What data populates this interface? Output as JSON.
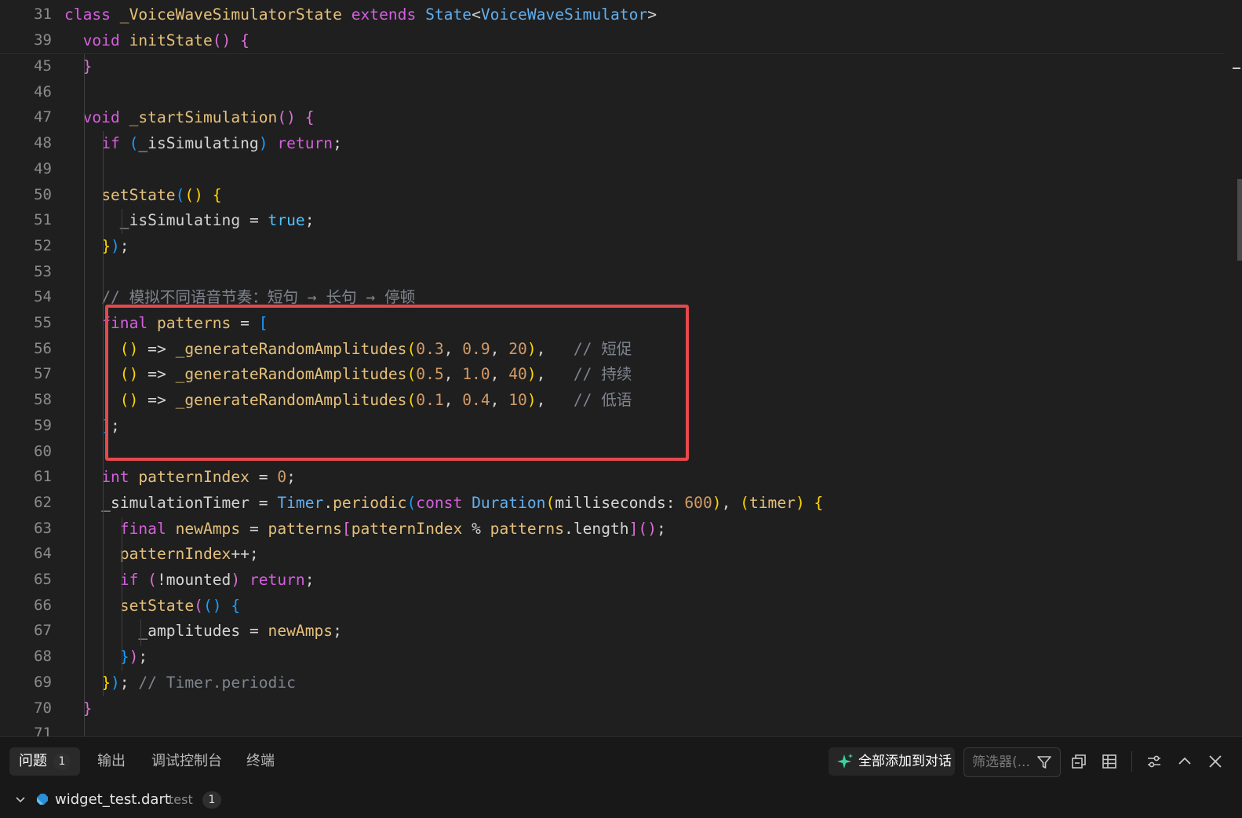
{
  "editor": {
    "sticky": [
      {
        "ln": "31",
        "tokens": [
          [
            "kw",
            "class "
          ],
          [
            "fn",
            "_VoiceWaveSimulatorState "
          ],
          [
            "kw",
            "extends "
          ],
          [
            "cl",
            "State"
          ],
          [
            "op",
            "<"
          ],
          [
            "cl",
            "VoiceWaveSimulator"
          ],
          [
            "op",
            ">"
          ]
        ]
      },
      {
        "ln": "39",
        "tokens": [
          [
            "tx",
            "  "
          ],
          [
            "kw",
            "void "
          ],
          [
            "fn",
            "initState"
          ],
          [
            "b2",
            "() {"
          ]
        ]
      }
    ],
    "lines": [
      {
        "ln": "45",
        "tokens": [
          [
            "tx",
            "  "
          ],
          [
            "b2",
            "}"
          ]
        ]
      },
      {
        "ln": "46",
        "tokens": []
      },
      {
        "ln": "47",
        "tokens": [
          [
            "tx",
            "  "
          ],
          [
            "kw",
            "void "
          ],
          [
            "fn",
            "_startSimulation"
          ],
          [
            "b2",
            "() {"
          ]
        ]
      },
      {
        "ln": "48",
        "tokens": [
          [
            "tx",
            "    "
          ],
          [
            "kw",
            "if "
          ],
          [
            "b3",
            "("
          ],
          [
            "tx",
            "_isSimulating"
          ],
          [
            "b3",
            ")"
          ],
          [
            "tx",
            " "
          ],
          [
            "kw",
            "return"
          ],
          [
            "op",
            ";"
          ]
        ]
      },
      {
        "ln": "49",
        "tokens": []
      },
      {
        "ln": "50",
        "tokens": [
          [
            "tx",
            "    "
          ],
          [
            "fn",
            "setState"
          ],
          [
            "b3",
            "("
          ],
          [
            "b1",
            "() {"
          ]
        ]
      },
      {
        "ln": "51",
        "tokens": [
          [
            "tx",
            "      _isSimulating "
          ],
          [
            "op",
            "= "
          ],
          [
            "ty",
            "true"
          ],
          [
            "op",
            ";"
          ]
        ]
      },
      {
        "ln": "52",
        "tokens": [
          [
            "tx",
            "    "
          ],
          [
            "b1",
            "}"
          ],
          [
            "b3",
            ")"
          ],
          [
            "op",
            ";"
          ]
        ]
      },
      {
        "ln": "53",
        "tokens": []
      },
      {
        "ln": "54",
        "tokens": [
          [
            "tx",
            "    "
          ],
          [
            "cm",
            "// 模拟不同语音节奏：短句 → 长句 → 停顿"
          ]
        ]
      },
      {
        "ln": "55",
        "tokens": [
          [
            "tx",
            "    "
          ],
          [
            "kw",
            "final "
          ],
          [
            "vr",
            "patterns "
          ],
          [
            "op",
            "= "
          ],
          [
            "b3",
            "["
          ]
        ]
      },
      {
        "ln": "56",
        "tokens": [
          [
            "tx",
            "      "
          ],
          [
            "b1",
            "()"
          ],
          [
            "op",
            " => "
          ],
          [
            "fn",
            "_generateRandomAmplitudes"
          ],
          [
            "b1",
            "("
          ],
          [
            "nm",
            "0.3"
          ],
          [
            "op",
            ", "
          ],
          [
            "nm",
            "0.9"
          ],
          [
            "op",
            ", "
          ],
          [
            "nm",
            "20"
          ],
          [
            "b1",
            ")"
          ],
          [
            "op",
            ",   "
          ],
          [
            "cm",
            "// 短促"
          ]
        ]
      },
      {
        "ln": "57",
        "tokens": [
          [
            "tx",
            "      "
          ],
          [
            "b1",
            "()"
          ],
          [
            "op",
            " => "
          ],
          [
            "fn",
            "_generateRandomAmplitudes"
          ],
          [
            "b1",
            "("
          ],
          [
            "nm",
            "0.5"
          ],
          [
            "op",
            ", "
          ],
          [
            "nm",
            "1.0"
          ],
          [
            "op",
            ", "
          ],
          [
            "nm",
            "40"
          ],
          [
            "b1",
            ")"
          ],
          [
            "op",
            ",   "
          ],
          [
            "cm",
            "// 持续"
          ]
        ]
      },
      {
        "ln": "58",
        "tokens": [
          [
            "tx",
            "      "
          ],
          [
            "b1",
            "()"
          ],
          [
            "op",
            " => "
          ],
          [
            "fn",
            "_generateRandomAmplitudes"
          ],
          [
            "b1",
            "("
          ],
          [
            "nm",
            "0.1"
          ],
          [
            "op",
            ", "
          ],
          [
            "nm",
            "0.4"
          ],
          [
            "op",
            ", "
          ],
          [
            "nm",
            "10"
          ],
          [
            "b1",
            ")"
          ],
          [
            "op",
            ",   "
          ],
          [
            "cm",
            "// 低语"
          ]
        ]
      },
      {
        "ln": "59",
        "tokens": [
          [
            "tx",
            "    "
          ],
          [
            "b3",
            "]"
          ],
          [
            "op",
            ";"
          ]
        ]
      },
      {
        "ln": "60",
        "tokens": []
      },
      {
        "ln": "61",
        "tokens": [
          [
            "tx",
            "    "
          ],
          [
            "kw",
            "int "
          ],
          [
            "vr",
            "patternIndex "
          ],
          [
            "op",
            "= "
          ],
          [
            "nm",
            "0"
          ],
          [
            "op",
            ";"
          ]
        ]
      },
      {
        "ln": "62",
        "tokens": [
          [
            "tx",
            "    _simulationTimer "
          ],
          [
            "op",
            "= "
          ],
          [
            "cl",
            "Timer"
          ],
          [
            "op",
            "."
          ],
          [
            "fn",
            "periodic"
          ],
          [
            "b3",
            "("
          ],
          [
            "kw",
            "const "
          ],
          [
            "cl",
            "Duration"
          ],
          [
            "b1",
            "("
          ],
          [
            "tx",
            "milliseconds: "
          ],
          [
            "nm",
            "600"
          ],
          [
            "b1",
            ")"
          ],
          [
            "op",
            ", "
          ],
          [
            "b1",
            "("
          ],
          [
            "vr",
            "timer"
          ],
          [
            "b1",
            ")"
          ],
          [
            "tx",
            " "
          ],
          [
            "b1",
            "{"
          ]
        ]
      },
      {
        "ln": "63",
        "tokens": [
          [
            "tx",
            "      "
          ],
          [
            "kw",
            "final "
          ],
          [
            "vr",
            "newAmps "
          ],
          [
            "op",
            "= "
          ],
          [
            "vr",
            "patterns"
          ],
          [
            "b2",
            "["
          ],
          [
            "vr",
            "patternIndex "
          ],
          [
            "op",
            "% "
          ],
          [
            "vr",
            "patterns"
          ],
          [
            "op",
            "."
          ],
          [
            "tx",
            "length"
          ],
          [
            "b2",
            "]"
          ],
          [
            "b2",
            "()"
          ],
          [
            "op",
            ";"
          ]
        ]
      },
      {
        "ln": "64",
        "tokens": [
          [
            "tx",
            "      "
          ],
          [
            "vr",
            "patternIndex"
          ],
          [
            "op",
            "++;"
          ]
        ]
      },
      {
        "ln": "65",
        "tokens": [
          [
            "tx",
            "      "
          ],
          [
            "kw",
            "if "
          ],
          [
            "b2",
            "("
          ],
          [
            "op",
            "!"
          ],
          [
            "tx",
            "mounted"
          ],
          [
            "b2",
            ")"
          ],
          [
            "tx",
            " "
          ],
          [
            "kw",
            "return"
          ],
          [
            "op",
            ";"
          ]
        ]
      },
      {
        "ln": "66",
        "tokens": [
          [
            "tx",
            "      "
          ],
          [
            "fn",
            "setState"
          ],
          [
            "b2",
            "("
          ],
          [
            "b3",
            "() {"
          ]
        ]
      },
      {
        "ln": "67",
        "tokens": [
          [
            "tx",
            "        _amplitudes "
          ],
          [
            "op",
            "= "
          ],
          [
            "vr",
            "newAmps"
          ],
          [
            "op",
            ";"
          ]
        ]
      },
      {
        "ln": "68",
        "tokens": [
          [
            "tx",
            "      "
          ],
          [
            "b3",
            "}"
          ],
          [
            "b2",
            ")"
          ],
          [
            "op",
            ";"
          ]
        ]
      },
      {
        "ln": "69",
        "tokens": [
          [
            "tx",
            "    "
          ],
          [
            "b1",
            "}"
          ],
          [
            "b3",
            ")"
          ],
          [
            "op",
            "; "
          ],
          [
            "cm",
            "// Timer.periodic"
          ]
        ]
      },
      {
        "ln": "70",
        "tokens": [
          [
            "tx",
            "  "
          ],
          [
            "b2",
            "}"
          ]
        ]
      },
      {
        "ln": "71",
        "tokens": []
      }
    ]
  },
  "panel": {
    "tabs": [
      {
        "label": "问题",
        "badge": "1",
        "active": true
      },
      {
        "label": "输出"
      },
      {
        "label": "调试控制台"
      },
      {
        "label": "终端"
      }
    ],
    "add_all_label": "全部添加到对话",
    "filter_placeholder": "筛选器(...",
    "tree": {
      "file": "widget_test.dart",
      "dir": "test",
      "count": "1"
    }
  },
  "colors": {
    "accent_spark": "#3fd1a0",
    "highlight_border": "#e5484d"
  }
}
